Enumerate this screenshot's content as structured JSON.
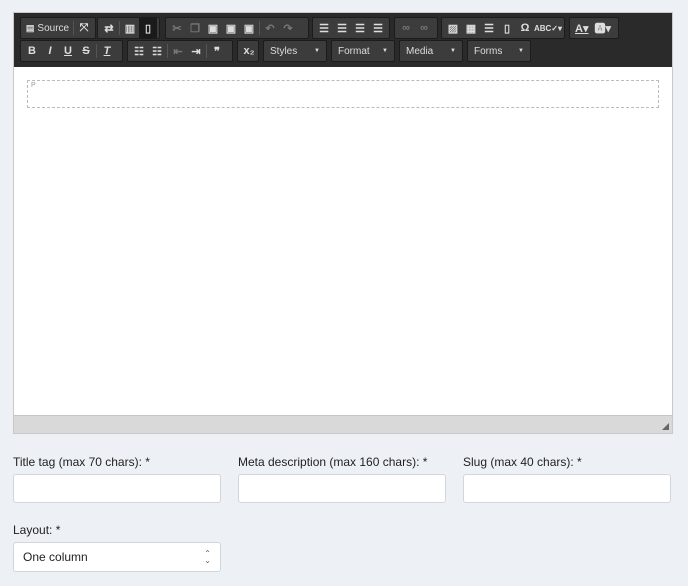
{
  "toolbar": {
    "source_label": "Source",
    "styles_label": "Styles",
    "format_label": "Format",
    "media_label": "Media",
    "forms_label": "Forms",
    "icons": [
      "source-icon",
      "maximize-icon",
      "show-blocks-icon",
      "template-icon",
      "preview-icon",
      "cut-icon",
      "copy-icon",
      "paste-icon",
      "paste-text-icon",
      "paste-word-icon",
      "undo-icon",
      "redo-icon",
      "align-left-icon",
      "align-center-icon",
      "align-right-icon",
      "justify-icon",
      "link-icon",
      "unlink-icon",
      "image-icon",
      "table-icon",
      "horizontal-rule-icon",
      "page-break-icon",
      "special-char-icon",
      "spellcheck-icon",
      "text-color-icon",
      "bg-color-icon",
      "bold-icon",
      "italic-icon",
      "underline-icon",
      "strike-icon",
      "remove-format-icon",
      "numbered-list-icon",
      "bulleted-list-icon",
      "outdent-icon",
      "indent-icon",
      "blockquote-icon",
      "subscript-icon"
    ]
  },
  "content": {
    "element_tag": "P"
  },
  "form": {
    "title_label": "Title tag (max 70 chars): *",
    "title_value": "",
    "meta_label": "Meta description (max 160 chars): *",
    "meta_value": "",
    "slug_label": "Slug (max 40 chars): *",
    "slug_value": "",
    "layout_label": "Layout: *",
    "layout_value": "One column"
  }
}
